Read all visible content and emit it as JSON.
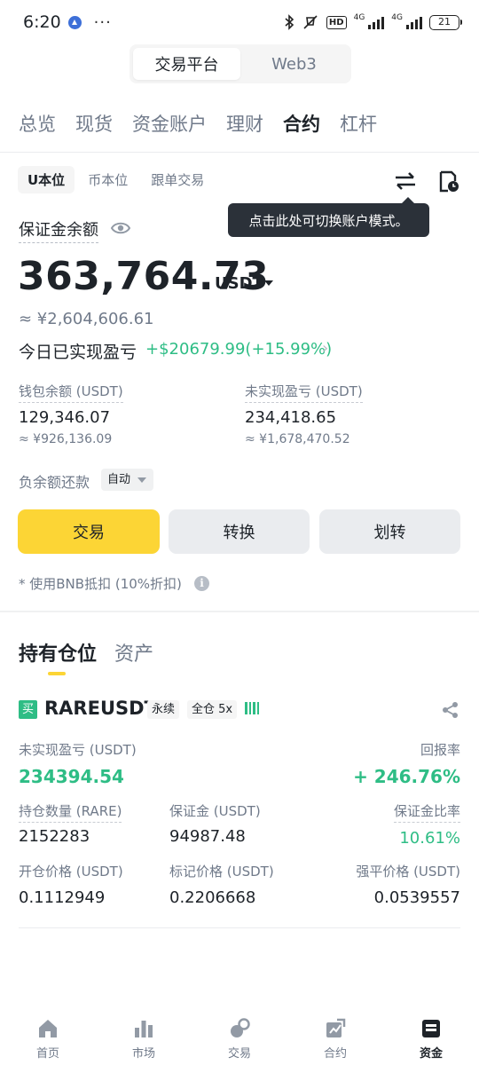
{
  "status_bar": {
    "time": "6:20",
    "dots": "···",
    "net1": "4G",
    "net2": "4G",
    "hd": "HD",
    "battery": "21"
  },
  "top_switch": {
    "items": [
      "交易平台",
      "Web3"
    ],
    "active": 0
  },
  "categories": [
    "总览",
    "现货",
    "资金账户",
    "理财",
    "合约",
    "杠杆"
  ],
  "sub_tabs": [
    "U本位",
    "币本位",
    "跟单交易"
  ],
  "tooltip": "点击此处可切换账户模式。",
  "margin_balance": {
    "label": "保证金余额",
    "value": "363,764.73",
    "unit": "USDT",
    "approx_cny": "≈ ¥2,604,606.61"
  },
  "today_pnl": {
    "label": "今日已实现盈亏",
    "value": "+$20679.99(+15.99%)",
    "chevron": "›"
  },
  "wallet": {
    "label": "钱包余额 (USDT)",
    "value": "129,346.07",
    "approx": "≈ ¥926,136.09"
  },
  "unrealized": {
    "label": "未实现盈亏 (USDT)",
    "value": "234,418.65",
    "approx": "≈ ¥1,678,470.52"
  },
  "negative_repay": {
    "label": "负余额还款",
    "option": "自动"
  },
  "actions": {
    "trade": "交易",
    "convert": "转换",
    "transfer": "划转"
  },
  "bnb_note": "* 使用BNB抵扣 (10%折扣)",
  "position_tabs": [
    "持有仓位",
    "资产"
  ],
  "position": {
    "side_badge": "买",
    "symbol": "RAREUSDT",
    "contract": "永续",
    "margin_mode": "全仓 5x",
    "unrealized_label": "未实现盈亏 (USDT)",
    "unrealized_value": "234394.54",
    "roe_label": "回报率",
    "roe_value": "+ 246.76%",
    "size_label": "持仓数量 (RARE)",
    "size_value": "2152283",
    "margin_label": "保证金 (USDT)",
    "margin_value": "94987.48",
    "margin_ratio_label": "保证金比率",
    "margin_ratio_value": "10.61%",
    "entry_label": "开仓价格 (USDT)",
    "entry_value": "0.1112949",
    "mark_label": "标记价格 (USDT)",
    "mark_value": "0.2206668",
    "liq_label": "强平价格 (USDT)",
    "liq_value": "0.0539557"
  },
  "bottom_nav": [
    {
      "label": "首页",
      "icon": "home-icon"
    },
    {
      "label": "市场",
      "icon": "market-chart-icon"
    },
    {
      "label": "交易",
      "icon": "trade-icon"
    },
    {
      "label": "合约",
      "icon": "futures-icon"
    },
    {
      "label": "资金",
      "icon": "wallet-icon"
    }
  ],
  "colors": {
    "accent": "#fcd535",
    "positive": "#2ebd85",
    "text": "#1e2329",
    "muted": "#707a8a"
  }
}
